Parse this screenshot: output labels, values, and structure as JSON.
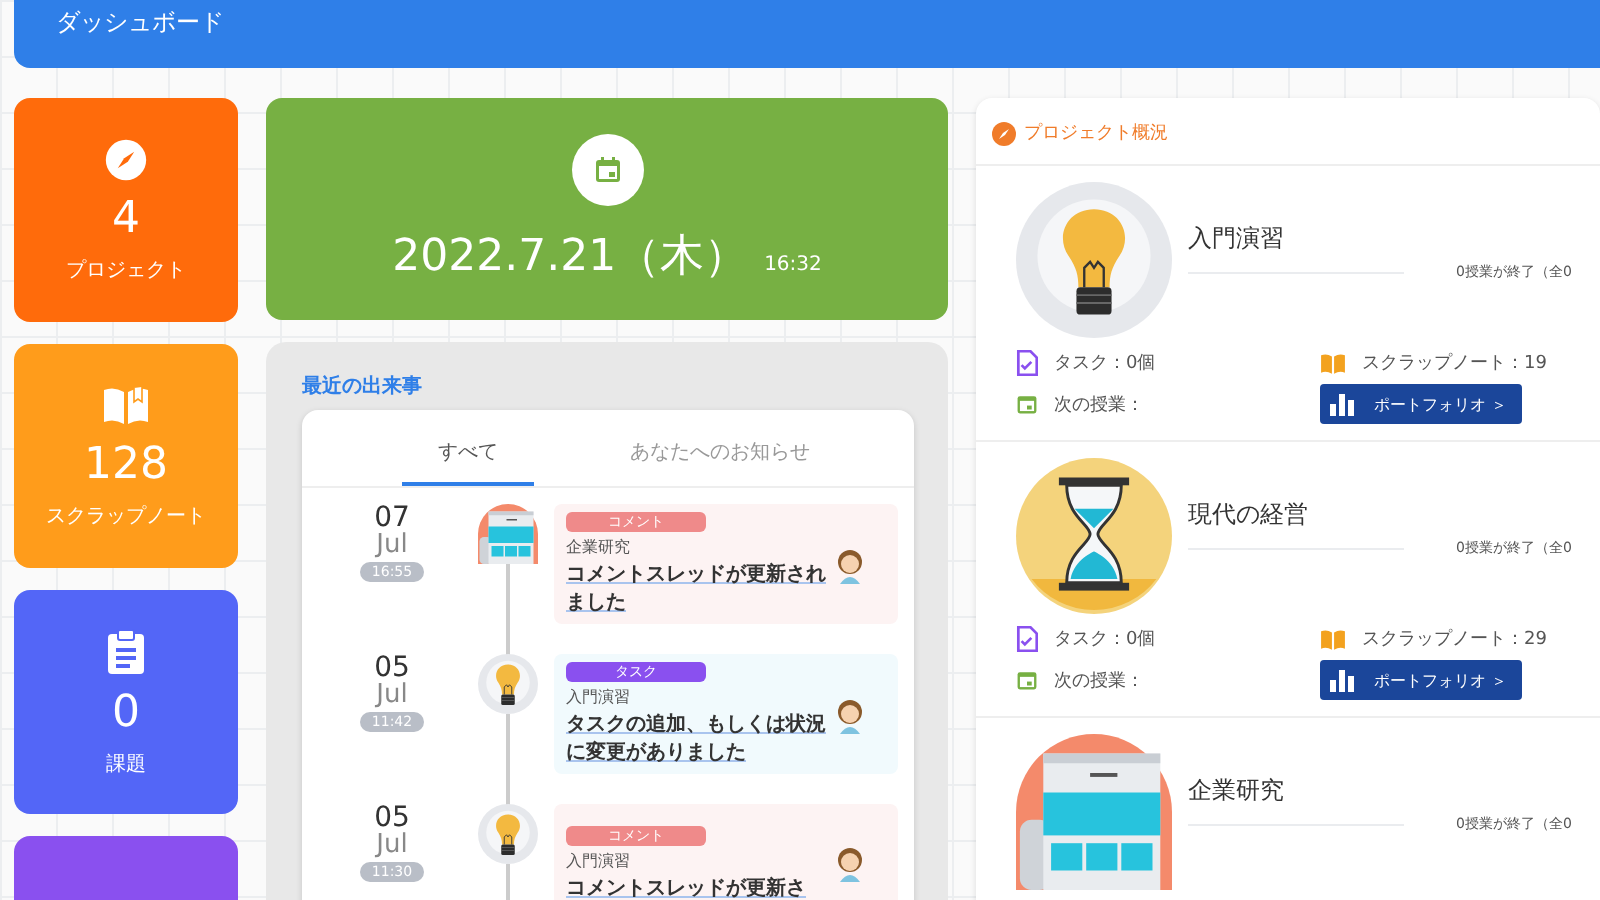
{
  "header": {
    "title": "ダッシュボード"
  },
  "stats": [
    {
      "color": "#ff6b0b",
      "value": "4",
      "label": "プロジェクト"
    },
    {
      "color": "#ff9c1b",
      "value": "128",
      "label": "スクラップノート"
    },
    {
      "color": "#5366f7",
      "value": "0",
      "label": "課題"
    },
    {
      "color": "#8a50ef"
    }
  ],
  "date_card": {
    "date": "2022.7.21（木）",
    "time": "16:32"
  },
  "events": {
    "title": "最近の出来事",
    "tabs": [
      {
        "label": "すべて",
        "selected": true
      },
      {
        "label": "あなたへのお知らせ",
        "selected": false
      }
    ],
    "items": [
      {
        "day": "07",
        "month": "Jul",
        "time": "16:55",
        "kind": "comment",
        "tag": "コメント",
        "color": "#ef8a8a",
        "project": "企業研究",
        "message": "コメントスレッドが更新されました"
      },
      {
        "day": "05",
        "month": "Jul",
        "time": "11:42",
        "kind": "task",
        "tag": "タスク",
        "color": "#8a50ef",
        "project": "入門演習",
        "message": "タスクの追加、もしくは状況に変更がありました"
      },
      {
        "day": "05",
        "month": "Jul",
        "time": "11:30",
        "kind": "comment",
        "tag": "コメント",
        "color": "#ef8a8a",
        "project": "入門演習",
        "message": "コメントスレッドが更新さ"
      }
    ]
  },
  "projects": {
    "title": "プロジェクト概況",
    "items": [
      {
        "name": "入門演習",
        "progress": "0授業が終了（全0",
        "tasks": "タスク：0個",
        "next": "次の授業：",
        "scrap": "スクラップノート：19",
        "button": "ポートフォリオ ＞"
      },
      {
        "name": "現代の経営",
        "progress": "0授業が終了（全0",
        "tasks": "タスク：0個",
        "next": "次の授業：",
        "scrap": "スクラップノート：29",
        "button": "ポートフォリオ ＞"
      },
      {
        "name": "企業研究",
        "progress": "0授業が終了（全0"
      }
    ]
  }
}
